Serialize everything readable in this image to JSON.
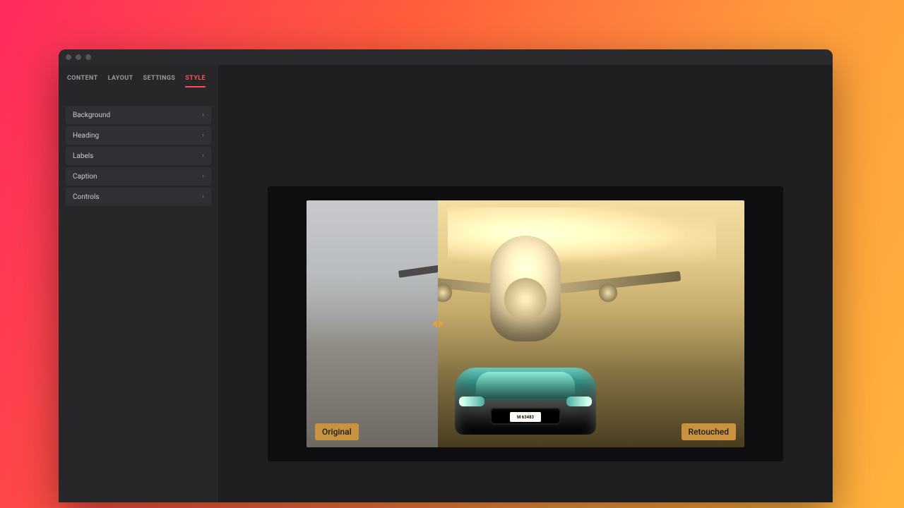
{
  "tabs": {
    "content": "CONTENT",
    "layout": "LAYOUT",
    "settings": "SETTINGS",
    "style": "STYLE"
  },
  "sidebar": {
    "items": [
      {
        "label": "Background"
      },
      {
        "label": "Heading"
      },
      {
        "label": "Labels"
      },
      {
        "label": "Caption"
      },
      {
        "label": "Controls"
      }
    ]
  },
  "compare": {
    "left_label": "Original",
    "right_label": "Retouched",
    "plate": "M 63483"
  },
  "colors": {
    "accent": "#ff4d5a",
    "pill": "#c8923e"
  }
}
